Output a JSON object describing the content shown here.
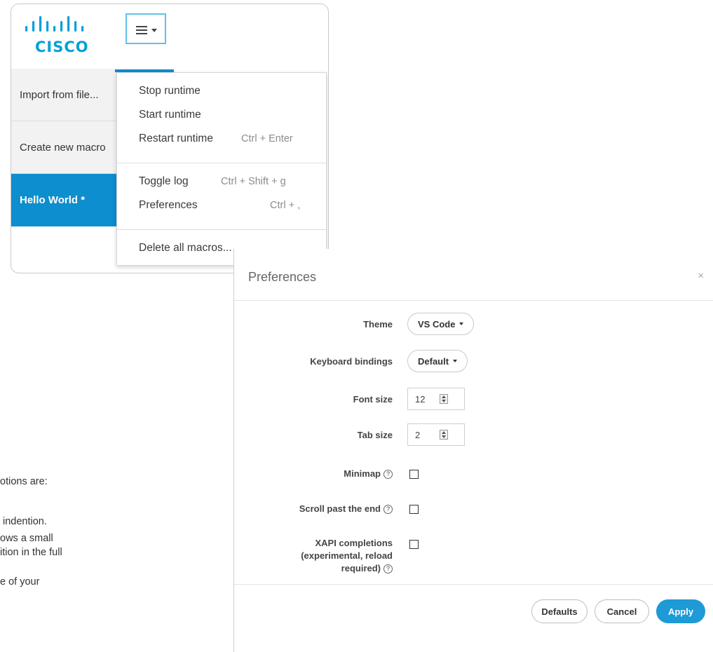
{
  "brand": {
    "logo_text": "CISCO",
    "color": "#049fd9"
  },
  "menu_button": {
    "icon": "hamburger-icon"
  },
  "sidebar": {
    "items": [
      {
        "label": "Import from file..."
      },
      {
        "label": "Create new macro"
      },
      {
        "label": "Hello World *",
        "active": true
      }
    ]
  },
  "dropdown": {
    "items": [
      {
        "label": "Stop runtime",
        "shortcut": ""
      },
      {
        "label": "Start runtime",
        "shortcut": ""
      },
      {
        "label": "Restart runtime",
        "shortcut": "Ctrl + Enter"
      },
      {
        "label": "Toggle log",
        "shortcut": "Ctrl + Shift + g"
      },
      {
        "label": "Preferences",
        "shortcut": "Ctrl + ,"
      },
      {
        "label": "Delete all macros...",
        "shortcut": ""
      }
    ]
  },
  "background_text": {
    "lines": [
      "otions are:",
      "indention.",
      "ows a small",
      "ition in the full",
      "e of your"
    ]
  },
  "preferences": {
    "title": "Preferences",
    "close": "×",
    "theme": {
      "label": "Theme",
      "value": "VS Code"
    },
    "keyboard": {
      "label": "Keyboard bindings",
      "value": "Default"
    },
    "font_size": {
      "label": "Font size",
      "value": "12"
    },
    "tab_size": {
      "label": "Tab size",
      "value": "2"
    },
    "minimap": {
      "label": "Minimap",
      "help": "?",
      "checked": false
    },
    "scroll_past_end": {
      "label": "Scroll past the end",
      "help": "?",
      "checked": false
    },
    "xapi": {
      "label": "XAPI completions (experimental, reload required)",
      "help": "?",
      "checked": false
    },
    "buttons": {
      "defaults": "Defaults",
      "cancel": "Cancel",
      "apply": "Apply"
    },
    "accent_color": "#1e9ad6"
  }
}
